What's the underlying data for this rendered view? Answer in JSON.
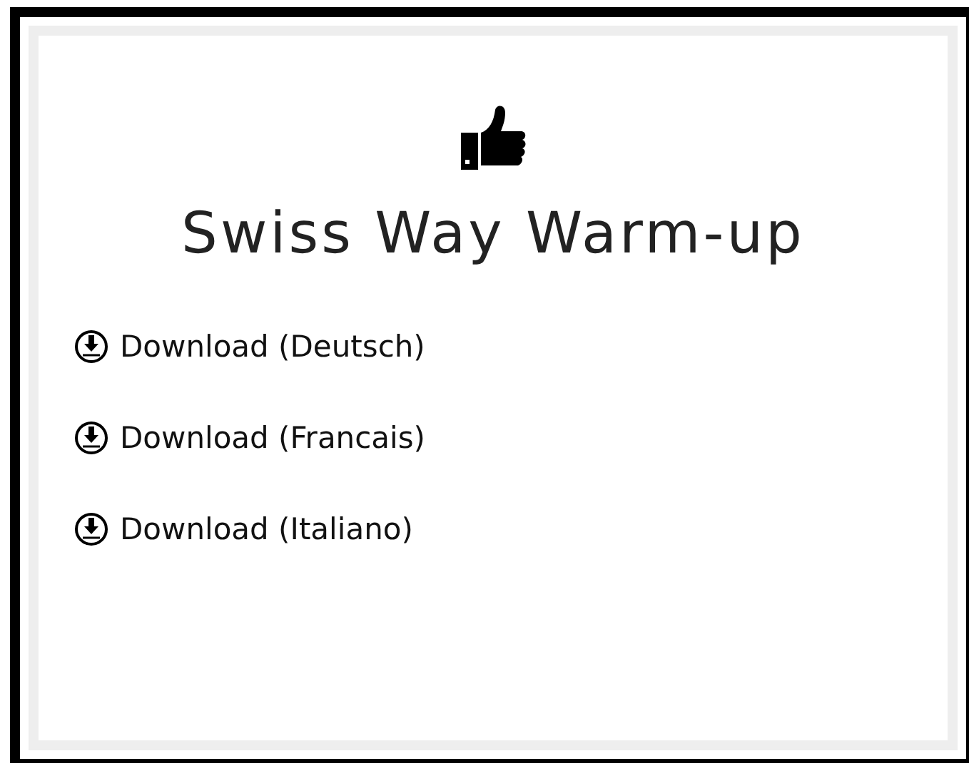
{
  "title": "Swiss Way Warm-up",
  "downloads": [
    {
      "label": "Download (Deutsch)"
    },
    {
      "label": "Download (Francais)"
    },
    {
      "label": "Download (Italiano)"
    }
  ]
}
